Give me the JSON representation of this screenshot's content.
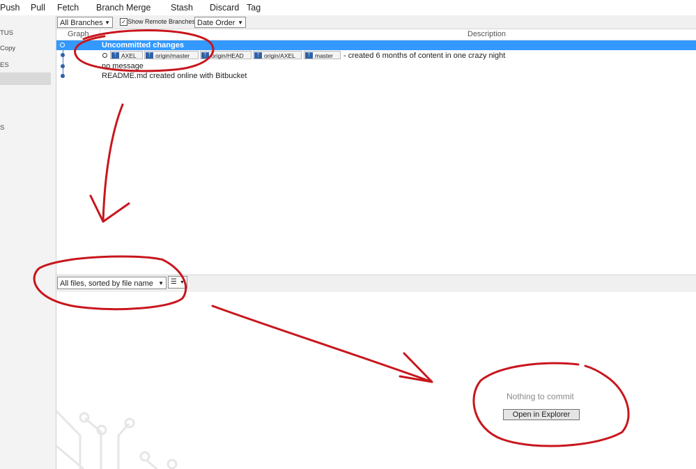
{
  "toolbar": {
    "items": [
      "Push",
      "Pull",
      "Fetch",
      "Branch",
      "Merge",
      "Stash",
      "Discard",
      "Tag"
    ]
  },
  "sidebar": {
    "status_label": "TUS",
    "copy_label": "Copy",
    "branches_label": "ES",
    "misc_label": "S"
  },
  "filters": {
    "branches_select": "All Branches",
    "show_remote_label": "Show Remote Branches",
    "show_remote_checked": true,
    "order_select": "Date Order"
  },
  "columns": {
    "graph": "Graph",
    "description": "Description"
  },
  "commits": {
    "uncommitted": "Uncommitted changes",
    "tags": [
      "AXEL",
      "origin/master",
      "origin/HEAD",
      "origin/AXEL",
      "master"
    ],
    "row1_message": "- created 6 months of content in one crazy night",
    "row2_message": "no message",
    "row3_message": "README.md created online with Bitbucket"
  },
  "files": {
    "sort_select": "All files, sorted by file name",
    "view_icon": "list-icon"
  },
  "workingcopy": {
    "empty_message": "Nothing to commit",
    "open_button": "Open in Explorer"
  },
  "colors": {
    "selection": "#3399ff",
    "branch_blue": "#2f62a8",
    "annotation_red": "#c8161d"
  }
}
